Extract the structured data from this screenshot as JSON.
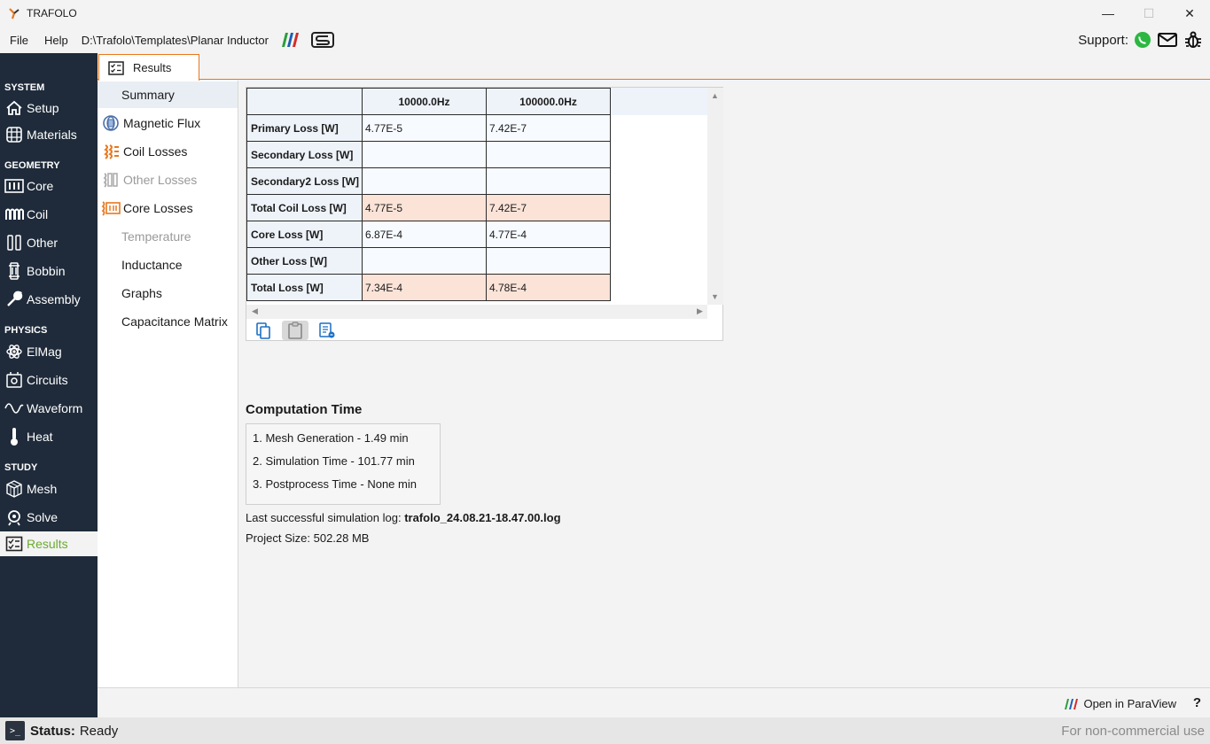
{
  "window": {
    "title": "TRAFOLO",
    "minimize": "—",
    "maximize": "☐",
    "close": "✕"
  },
  "menu": {
    "file": "File",
    "help": "Help",
    "path": "D:\\Trafolo\\Templates\\Planar Inductor"
  },
  "support": {
    "label": "Support:"
  },
  "sidebar": {
    "sections": {
      "system": "SYSTEM",
      "geometry": "GEOMETRY",
      "physics": "PHYSICS",
      "study": "STUDY"
    },
    "items": {
      "setup": "Setup",
      "materials": "Materials",
      "core": "Core",
      "coil": "Coil",
      "other": "Other",
      "bobbin": "Bobbin",
      "assembly": "Assembly",
      "elmag": "ElMag",
      "circuits": "Circuits",
      "waveform": "Waveform",
      "heat": "Heat",
      "mesh": "Mesh",
      "solve": "Solve",
      "results": "Results"
    }
  },
  "tab": {
    "label": "Results"
  },
  "subnav": {
    "summary": "Summary",
    "magnetic_flux": "Magnetic Flux",
    "coil_losses": "Coil Losses",
    "other_losses": "Other Losses",
    "core_losses": "Core Losses",
    "temperature": "Temperature",
    "inductance": "Inductance",
    "graphs": "Graphs",
    "capacitance": "Capacitance Matrix"
  },
  "table": {
    "columns": [
      "10000.0Hz",
      "100000.0Hz"
    ],
    "rows": [
      {
        "label": "Primary Loss [W]",
        "values": [
          "4.77E-5",
          "7.42E-7"
        ],
        "highlight": false
      },
      {
        "label": "Secondary Loss [W]",
        "values": [
          "",
          ""
        ],
        "highlight": false
      },
      {
        "label": "Secondary2 Loss [W]",
        "values": [
          "",
          ""
        ],
        "highlight": false
      },
      {
        "label": "Total Coil Loss [W]",
        "values": [
          "4.77E-5",
          "7.42E-7"
        ],
        "highlight": true
      },
      {
        "label": "Core Loss [W]",
        "values": [
          "6.87E-4",
          "4.77E-4"
        ],
        "highlight": false
      },
      {
        "label": "Other Loss [W]",
        "values": [
          "",
          ""
        ],
        "highlight": false
      },
      {
        "label": "Total Loss [W]",
        "values": [
          "7.34E-4",
          "4.78E-4"
        ],
        "highlight": true
      }
    ]
  },
  "computation": {
    "title": "Computation Time",
    "lines": [
      "1. Mesh Generation -  1.49 min",
      "2. Simulation Time -  101.77 min",
      "3. Postprocess Time -  None min"
    ],
    "log_label": "Last successful simulation log:",
    "log_file": "trafolo_24.08.21-18.47.00.log",
    "size_label": "Project Size:",
    "size_value": "502.28 MB"
  },
  "footer": {
    "paraview": "Open in ParaView",
    "help": "?"
  },
  "status": {
    "label": "Status:",
    "value": "Ready",
    "license": "For non-commercial use"
  },
  "colors": {
    "sidebar_bg": "#1f2b3a",
    "accent_orange": "#e8781e",
    "active_green": "#6aab2e",
    "highlight_cell": "#fbe3d8"
  }
}
